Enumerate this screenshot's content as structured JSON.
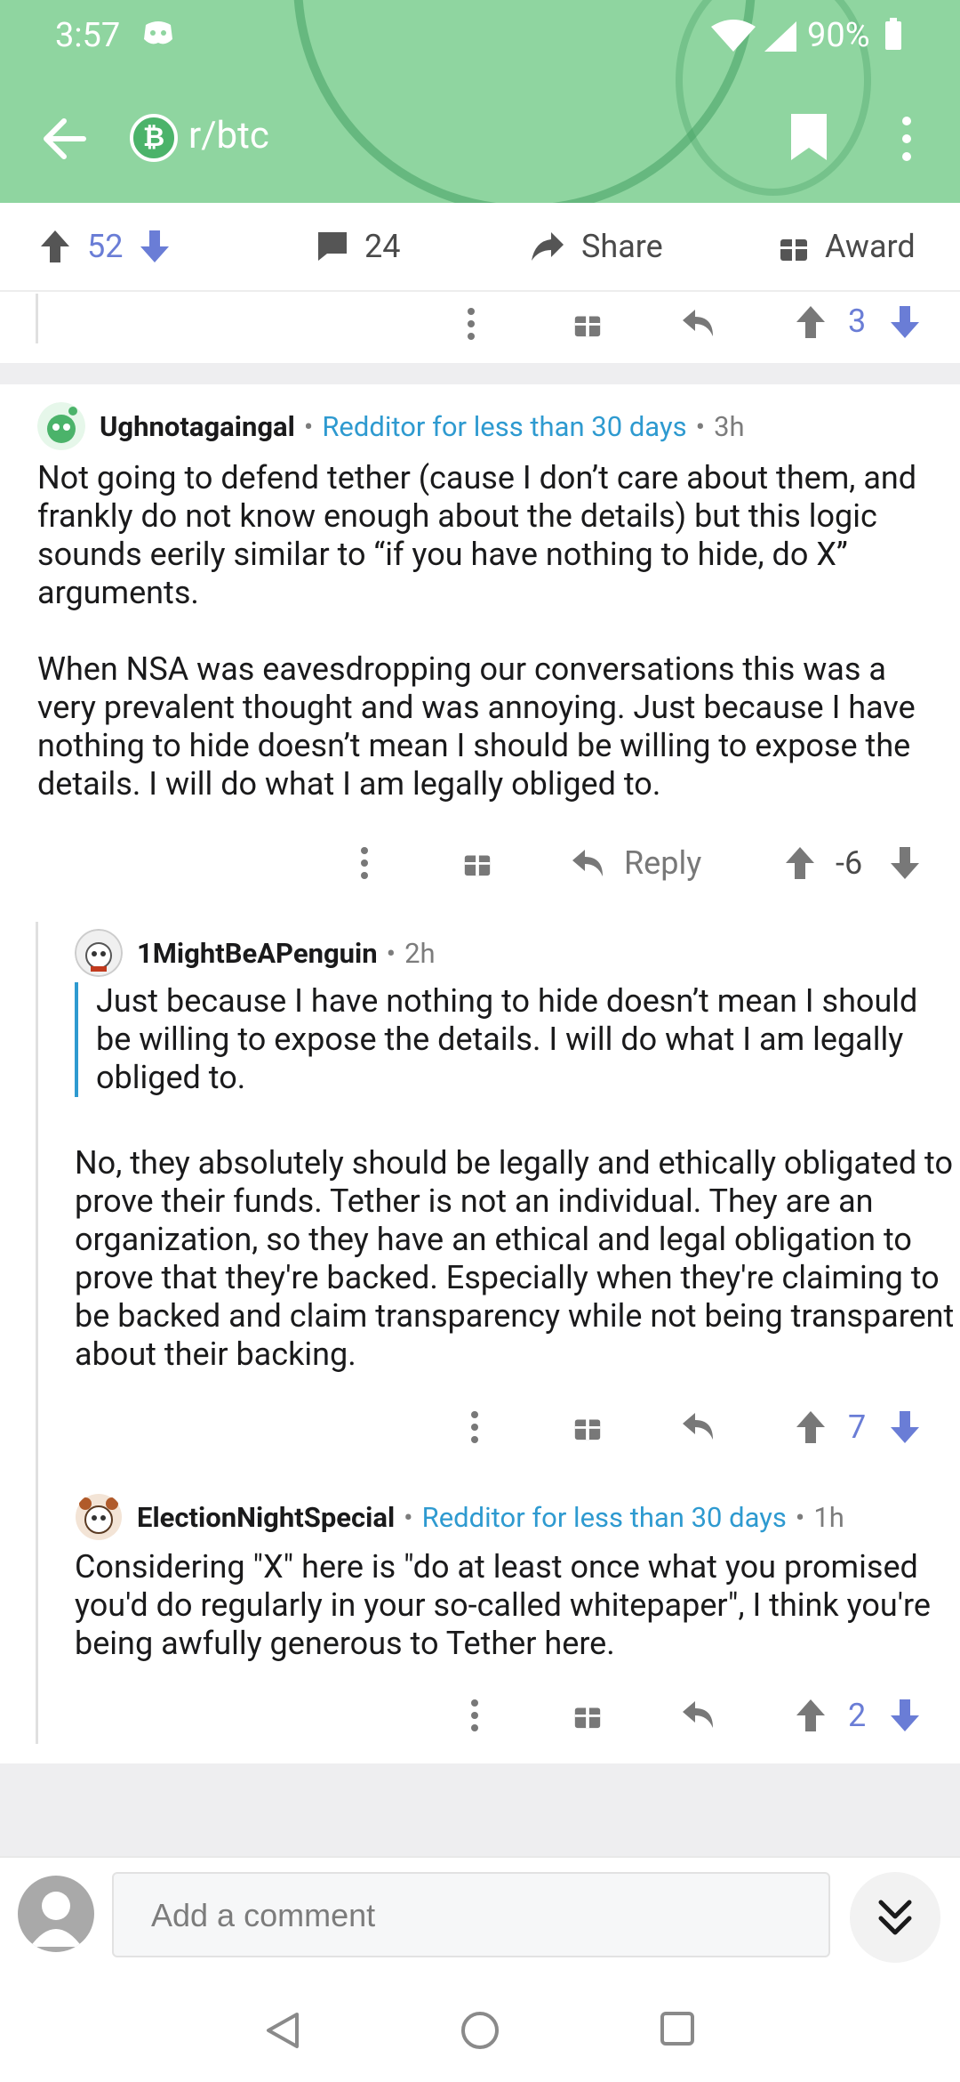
{
  "status_bar": {
    "time": "3:57",
    "battery": "90%"
  },
  "header": {
    "subreddit": "r/btc"
  },
  "post_actions": {
    "upvotes": "52",
    "comments": "24",
    "share_label": "Share",
    "award_label": "Award"
  },
  "top_comment_remnant": {
    "score": "3"
  },
  "comments": [
    {
      "username": "Ughnotagaingal",
      "flair": "Redditor for less than 30 days",
      "age": "3h",
      "paragraphs": [
        "Not going to defend tether (cause I don’t care about them, and frankly do not know enough about the details) but this logic sounds eerily similar to “if you have nothing to hide, do X” arguments.",
        "When NSA was eavesdropping our conversations this was a very prevalent thought and was annoying. Just because I have nothing to hide doesn’t mean I should be willing to expose the details. I will do what I am legally obliged to."
      ],
      "reply_label": "Reply",
      "score": "-6"
    },
    {
      "username": "1MightBeAPenguin",
      "age": "2h",
      "quote": "Just because I have nothing to hide doesn’t mean I should be willing to expose the details. I will do what I am legally obliged to.",
      "paragraphs": [
        "No, they absolutely should be legally and ethically obligated to prove their funds. Tether is not an individual. They are an organization, so they have an ethical and legal obligation to prove that they're backed. Especially when they're claiming to be backed and claim transparency while not being transparent about their backing."
      ],
      "score": "7"
    },
    {
      "username": "ElectionNightSpecial",
      "flair": "Redditor for less than 30 days",
      "age": "1h",
      "paragraphs": [
        "Considering \"X\" here is \"do at least once what you promised you'd do regularly in your so-called whitepaper\", I think you're being awfully generous to Tether here."
      ],
      "score": "2"
    }
  ],
  "composer": {
    "placeholder": "Add a comment"
  },
  "colors": {
    "header_bg": "#8fd5a0",
    "flair": "#2e9ad0",
    "vote_blue": "#6a7dd6"
  }
}
